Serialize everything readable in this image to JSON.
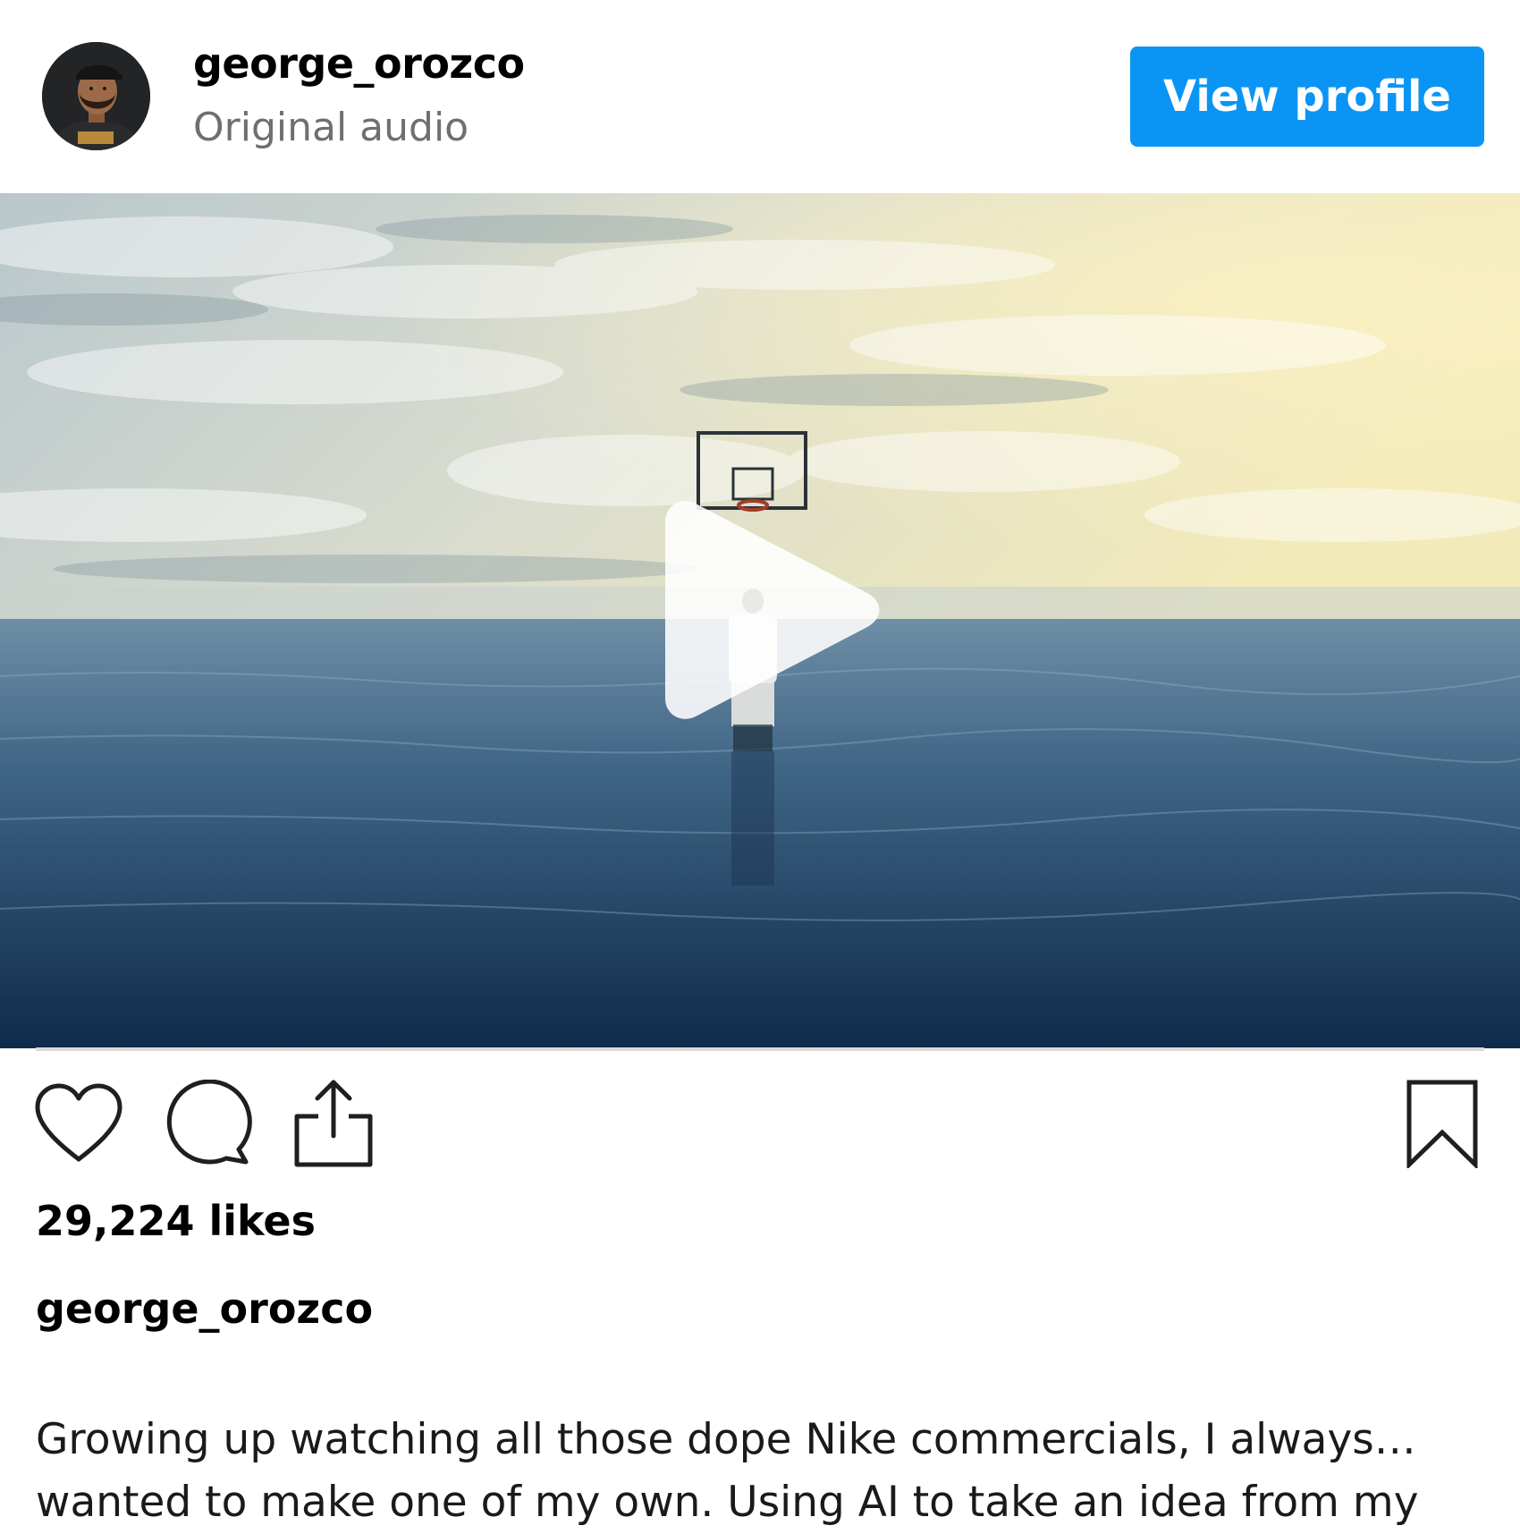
{
  "header": {
    "username": "george_orozco",
    "subtitle": "Original audio",
    "view_profile_label": "View profile"
  },
  "media": {
    "type": "video",
    "icon": "play-icon"
  },
  "actions": {
    "icons": [
      "heart-icon",
      "comment-icon",
      "share-icon",
      "bookmark-icon"
    ]
  },
  "post": {
    "likes": "29,224 likes",
    "caption_username": "george_orozco",
    "caption_line_1": "Growing up watching all those dope Nike commercials, I always…",
    "caption_line_2": "wanted to make one of my own. Using AI to take an idea from my"
  },
  "colors": {
    "accent": "#0a95f5",
    "secondary_text": "#6f6f6f"
  }
}
